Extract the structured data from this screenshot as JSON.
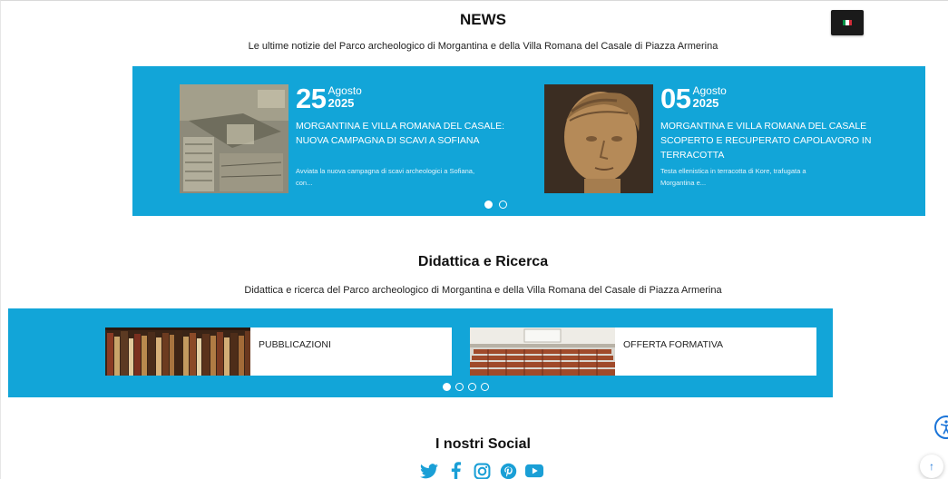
{
  "language": {
    "current": "it",
    "flag_colors": [
      "#009246",
      "#ffffff",
      "#ce2b37"
    ]
  },
  "news": {
    "title": "NEWS",
    "subtitle": "Le ultime notizie del Parco archeologico di Morgantina e della Villa Romana del Casale di Piazza Armerina",
    "items": [
      {
        "day": "25",
        "month": "Agosto",
        "year": "2025",
        "title": "MORGANTINA E VILLA ROMANA DEL CASALE:\nNUOVA CAMPAGNA DI SCAVI A SOFIANA",
        "excerpt": "Avviata la nuova campagna di scavi archeologici a Sofiana,\ncon..."
      },
      {
        "day": "05",
        "month": "Agosto",
        "year": "2025",
        "title": "MORGANTINA E VILLA ROMANA DEL CASALE\nSCOPERTO E RECUPERATO CAPOLAVORO IN\nTERRACOTTA",
        "excerpt": "Testa ellenistica in terracotta di Kore, trafugata a\nMorgantina e..."
      }
    ],
    "pagination": {
      "pages": 2,
      "active": 1
    }
  },
  "didattica": {
    "title": "Didattica e Ricerca",
    "subtitle": "Didattica e ricerca del Parco archeologico di Morgantina e della Villa Romana del Casale di Piazza Armerina",
    "items": [
      {
        "label": "PUBBLICAZIONI"
      },
      {
        "label": "OFFERTA FORMATIVA"
      }
    ],
    "pagination": {
      "pages": 4,
      "active": 1
    }
  },
  "social": {
    "title": "I nostri Social",
    "icons": [
      "twitter-icon",
      "facebook-icon",
      "instagram-icon",
      "pinterest-icon",
      "youtube-icon"
    ]
  },
  "colors": {
    "accent": "#12a5d8",
    "social": "#1a9fd6",
    "a11y": "#1a74d8"
  }
}
